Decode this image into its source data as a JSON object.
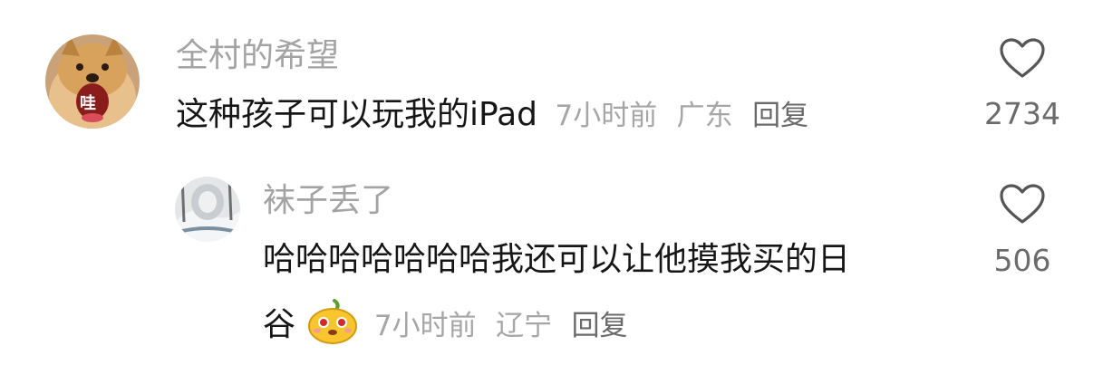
{
  "comments": [
    {
      "username": "全村的希望",
      "avatar_badge": "哇",
      "text": "这种孩子可以玩我的iPad",
      "time": "7小时前",
      "location": "广东",
      "reply_label": "回复",
      "likes": "2734"
    }
  ],
  "replies": [
    {
      "username": "袜子丢了",
      "text_line1": "哈哈哈哈哈哈哈我还可以让他摸我买的日",
      "text_line2": "谷",
      "emoji": "smiling-pear-emoji",
      "time": "7小时前",
      "location": "辽宁",
      "reply_label": "回复",
      "likes": "506"
    }
  ],
  "icons": {
    "like": "heart-outline-icon"
  },
  "colors": {
    "text": "#161616",
    "username": "#a3a3a3",
    "meta": "#a6a6a6",
    "reply": "#6a6a6a",
    "icon": "#555555"
  }
}
